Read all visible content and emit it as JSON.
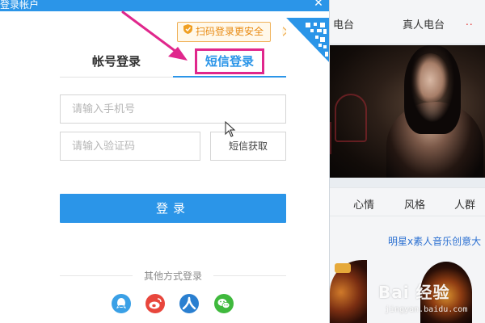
{
  "modal": {
    "title": "登录帐户",
    "close_glyph": "✕",
    "qr_badge": "扫码登录更安全",
    "tabs": [
      {
        "label": "帐号登录",
        "active": false
      },
      {
        "label": "短信登录",
        "active": true
      }
    ],
    "phone_placeholder": "请输入手机号",
    "phone_value": "",
    "code_placeholder": "请输入验证码",
    "code_value": "",
    "get_code_label": "短信获取",
    "login_label": "登录",
    "other_methods_label": "其他方式登录",
    "social_icons": [
      "qq-icon",
      "weibo-icon",
      "renren-icon",
      "wechat-icon"
    ]
  },
  "background": {
    "header_tabs": [
      "电台",
      "真人电台"
    ],
    "header_dots": "..",
    "category_tags": [
      "心情",
      "风格",
      "人群"
    ],
    "promo_link": "明星x素人音乐创意大"
  },
  "watermark": {
    "logo_text": "Bai 经验",
    "url": "jingyan.baidu.com"
  },
  "colors": {
    "brand_blue": "#2b95e8",
    "badge_orange": "#e88a12",
    "highlight_magenta": "#e0278c"
  }
}
